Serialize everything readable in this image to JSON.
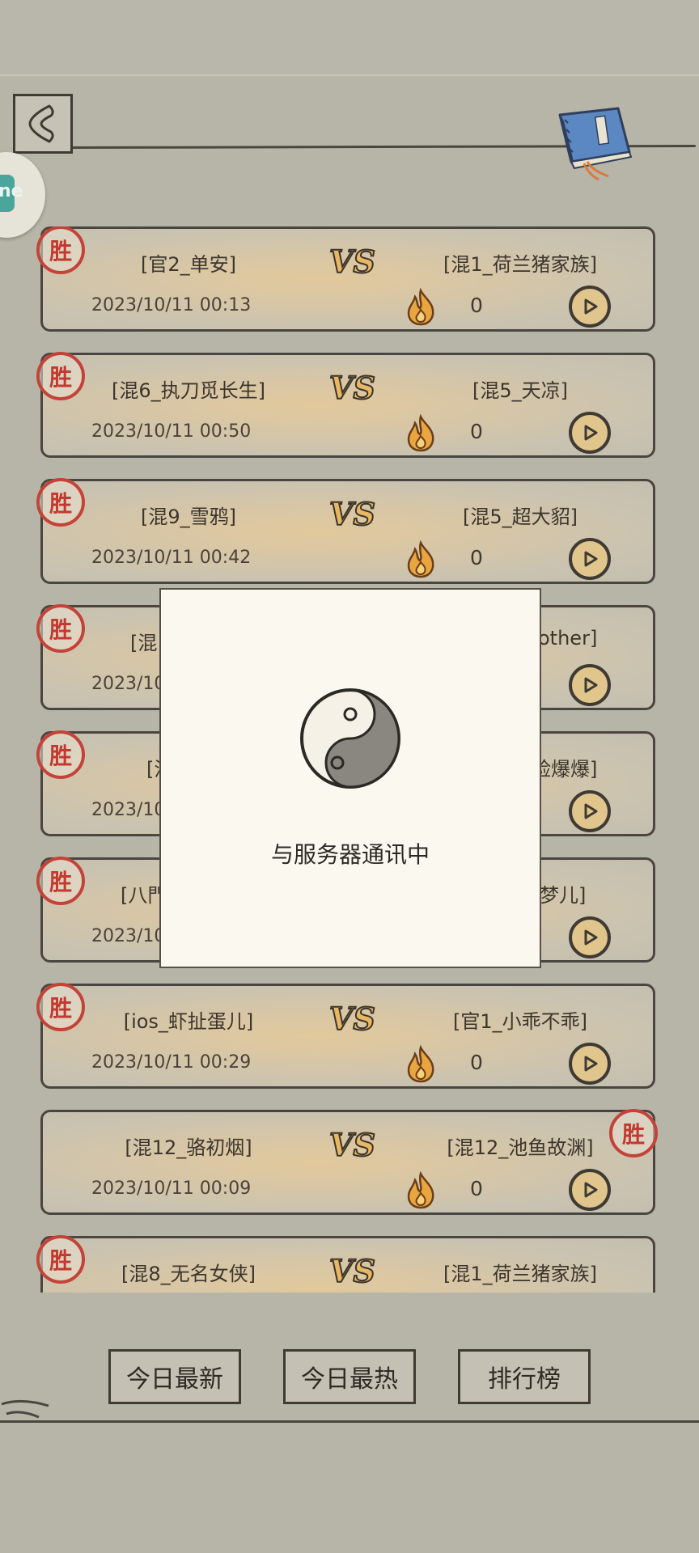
{
  "header": {
    "back_icon": "back-arrow-icon",
    "book_icon": "blue-book-icon",
    "side_widget_text": "ne"
  },
  "matches": [
    {
      "left": "[官2_单安]",
      "right": "[混1_荷兰猪家族]",
      "time": "2023/10/11 00:13",
      "heat": "0",
      "winner": "left"
    },
    {
      "left": "[混6_执刀觅长生]",
      "right": "[混5_天凉]",
      "time": "2023/10/11 00:50",
      "heat": "0",
      "winner": "left"
    },
    {
      "left": "[混9_雪鸦]",
      "right": "[混5_超大貂]",
      "time": "2023/10/11 00:42",
      "heat": "0",
      "winner": "left"
    },
    {
      "left": "[混",
      "right": "other]",
      "time": "2023/10",
      "heat": "",
      "winner": "left"
    },
    {
      "left": "[混",
      "right": "脸爆爆]",
      "time": "2023/10",
      "heat": "",
      "winner": "left"
    },
    {
      "left": "[八門",
      "right": "梦儿]",
      "time": "2023/10",
      "heat": "",
      "winner": "left"
    },
    {
      "left": "[ios_虾扯蛋儿]",
      "right": "[官1_小乖不乖]",
      "time": "2023/10/11 00:29",
      "heat": "0",
      "winner": "left"
    },
    {
      "left": "[混12_骆初烟]",
      "right": "[混12_池鱼故渊]",
      "time": "2023/10/11 00:09",
      "heat": "0",
      "winner": "right"
    },
    {
      "left": "[混8_无名女侠]",
      "right": "[混1_荷兰猪家族]",
      "time": "",
      "heat": "",
      "winner": "left"
    }
  ],
  "labels": {
    "win_stamp": "胜",
    "vs": "VS"
  },
  "tabs": {
    "today_new": "今日最新",
    "today_hot": "今日最热",
    "ranking": "排行榜"
  },
  "loading": {
    "message": "与服务器通讯中",
    "icon": "yin-yang-icon"
  },
  "colors": {
    "background": "#b7b5a8",
    "stamp_red": "#c44339",
    "play_fill": "#e0c68c",
    "book_blue": "#5b87c2"
  }
}
